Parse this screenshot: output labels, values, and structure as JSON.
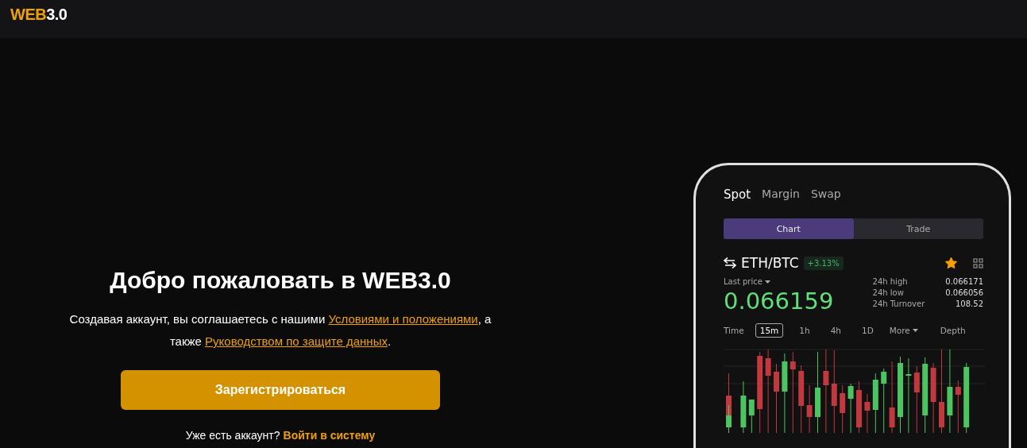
{
  "header": {
    "logo_accent": "WEB",
    "logo_rest": "3.0"
  },
  "hero": {
    "title": "Добро пожаловать в WEB3.0",
    "terms": [
      {
        "kind": "text",
        "text": "Создавая аккаунт, вы соглашаетесь с нашими "
      },
      {
        "kind": "link",
        "text": "Условиями и положениями"
      },
      {
        "kind": "text",
        "text": ", а также "
      },
      {
        "kind": "link",
        "text": "Руководством по защите данных"
      },
      {
        "kind": "text",
        "text": "."
      }
    ],
    "register_button": "Зарегистрироваться",
    "login_prompt": "Уже есть аккаунт?",
    "login_link": "Войти в систему"
  },
  "phone": {
    "tabs": [
      {
        "label": "Spot",
        "selected": true
      },
      {
        "label": "Margin",
        "selected": false
      },
      {
        "label": "Swap",
        "selected": false
      }
    ],
    "segments": [
      {
        "label": "Chart",
        "selected": true
      },
      {
        "label": "Trade",
        "selected": false
      }
    ],
    "pair": "ETH/BTC",
    "change": "+3.13%",
    "favorite": true,
    "last_price_label": "Last price",
    "last_price": "0.066159",
    "stats": [
      {
        "label": "24h high",
        "value": "0.066171"
      },
      {
        "label": "24h low",
        "value": "0.066056"
      },
      {
        "label": "24h Turnover",
        "value": "108.52"
      }
    ],
    "time_label": "Time",
    "intervals": [
      {
        "label": "15m",
        "selected": true
      },
      {
        "label": "1h",
        "selected": false
      },
      {
        "label": "4h",
        "selected": false
      },
      {
        "label": "1D",
        "selected": false
      }
    ],
    "more": "More",
    "depth": "Depth"
  }
}
